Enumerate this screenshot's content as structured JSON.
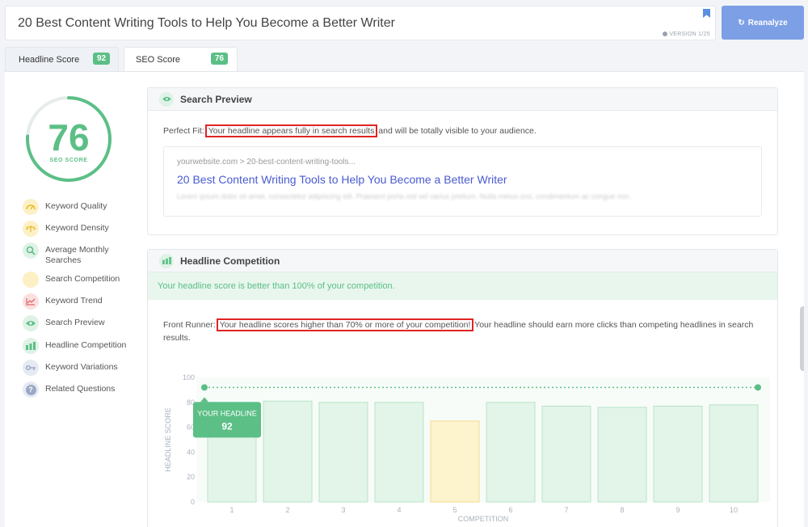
{
  "header": {
    "headline": "20 Best Content Writing Tools to Help You Become a Better Writer",
    "version": "VERSION 1/25",
    "reanalyze_label": "Reanalyze"
  },
  "tabs": [
    {
      "label": "Headline Score",
      "badge": "92"
    },
    {
      "label": "SEO Score",
      "badge": "76"
    }
  ],
  "seo_score": {
    "value": "76",
    "label": "SEO SCORE",
    "progress": 0.76
  },
  "sidebar": {
    "items": [
      {
        "label": "Keyword Quality",
        "icon": "gauge-icon",
        "color": "#f6d879"
      },
      {
        "label": "Keyword Density",
        "icon": "scale-icon",
        "color": "#f6d879"
      },
      {
        "label": "Average Monthly Searches",
        "icon": "search-icon",
        "color": "#5cbf86"
      },
      {
        "label": "Search Competition",
        "icon": "competition-icon",
        "color": "#f6d879"
      },
      {
        "label": "Keyword Trend",
        "icon": "trend-icon",
        "color": "#e06666"
      },
      {
        "label": "Search Preview",
        "icon": "eye-icon",
        "color": "#5cbf86"
      },
      {
        "label": "Headline Competition",
        "icon": "chart-icon",
        "color": "#5cbf86"
      },
      {
        "label": "Keyword Variations",
        "icon": "key-icon",
        "color": "#9aa7c6"
      },
      {
        "label": "Related Questions",
        "icon": "question-icon",
        "color": "#9aa7c6"
      }
    ]
  },
  "search_preview": {
    "title": "Search Preview",
    "fit_prefix": "Perfect Fit:",
    "fit_highlight": "Your headline appears fully in search results",
    "fit_suffix": "and will be totally visible to your audience.",
    "serp_url": "yourwebsite.com > 20-best-content-writing-tools...",
    "serp_title": "20 Best Content Writing Tools to Help You Become a Better Writer",
    "serp_desc": "Lorem ipsum dolor sit amet, consectetur adipiscing elit. Praesent porta nisl vel varius pretium. Nulla metus orci, condimentum ac congue non."
  },
  "headline_competition": {
    "title": "Headline Competition",
    "banner": "Your headline score is better than 100% of your competition.",
    "runner_prefix": "Front Runner:",
    "runner_highlight": "Your headline scores higher than 70% or more of your competition!",
    "runner_suffix": "Your headline should earn more clicks than competing headlines in search results."
  },
  "colors": {
    "accent": "#5cbf86",
    "button": "#7d9fe6",
    "highlight_box": "#e02424",
    "bar": "#e2f5e8",
    "bar_weak": "#fdf3cd"
  },
  "chart_data": {
    "type": "bar",
    "xlabel": "COMPETITION",
    "ylabel": "HEADLINE SCORE",
    "ylim": [
      0,
      100
    ],
    "yticks": [
      0,
      20,
      40,
      60,
      80,
      100
    ],
    "categories": [
      "1",
      "2",
      "3",
      "4",
      "5",
      "6",
      "7",
      "8",
      "9",
      "10"
    ],
    "values": [
      80,
      81,
      80,
      80,
      65,
      80,
      77,
      76,
      77,
      78
    ],
    "highlight_index": 4,
    "your_headline": {
      "label": "YOUR HEADLINE",
      "value": 92
    },
    "reference_line": 92
  }
}
